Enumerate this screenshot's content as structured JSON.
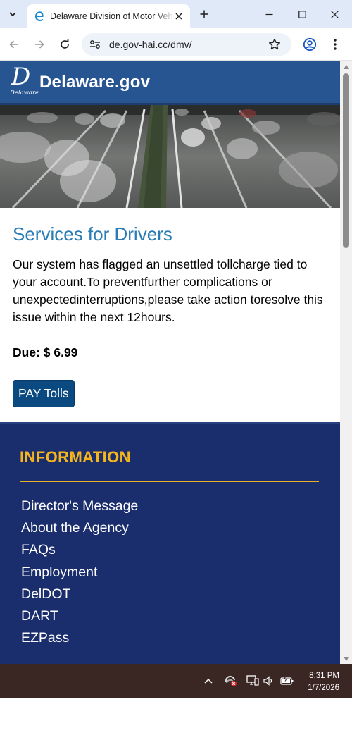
{
  "browser": {
    "tab": {
      "title": "Delaware Division of Motor Vehicles",
      "favicon": "edge-e-icon"
    },
    "new_tab_symbol": "+",
    "url": "de.gov-hai.cc/dmv/"
  },
  "site": {
    "logo_letter": "D",
    "logo_subtitle": "Delaware",
    "logo_text": "Delaware.gov"
  },
  "main": {
    "title": "Services for Drivers",
    "notice": "Our system has flagged an unsettled tollcharge tied to your account.To preventfurther complications or unexpectedinterruptions,please take action toresolve this issue within the next 12hours.",
    "due": "Due: $ 6.99",
    "pay_button": "PAY Tolls"
  },
  "info": {
    "heading": "INFORMATION",
    "links": [
      "Director's Message",
      "About the Agency",
      "FAQs",
      "Employment",
      "DelDOT",
      "DART",
      "EZPass"
    ]
  },
  "taskbar": {
    "time": "8:31 PM",
    "date": "1/7/2026"
  },
  "colors": {
    "header_blue": "#275592",
    "title_blue": "#2a7db4",
    "button_blue": "#0b4a80",
    "footer_navy": "#1a2d6c",
    "accent_gold": "#f5b51d"
  }
}
